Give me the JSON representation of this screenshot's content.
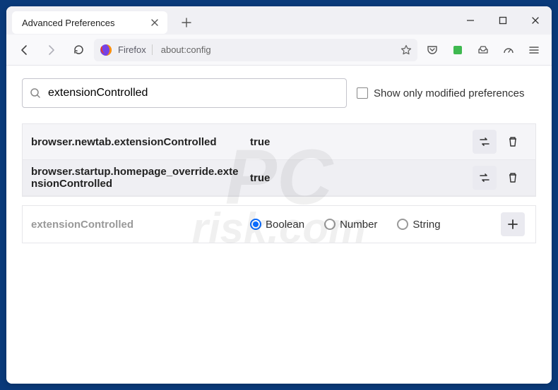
{
  "window": {
    "tab_title": "Advanced Preferences",
    "sys": {
      "min": "–",
      "max": "☐",
      "close": "✕"
    }
  },
  "toolbar": {
    "identity": "Firefox",
    "url": "about:config"
  },
  "search": {
    "value": "extensionControlled",
    "checkbox_label": "Show only modified preferences"
  },
  "prefs": [
    {
      "name": "browser.newtab.extensionControlled",
      "value": "true"
    },
    {
      "name": "browser.startup.homepage_override.extensionControlled",
      "value": "true"
    }
  ],
  "addrow": {
    "name": "extensionControlled",
    "types": [
      "Boolean",
      "Number",
      "String"
    ],
    "selected": 0
  },
  "watermark": {
    "line1": "PC",
    "line2": "risk.com"
  }
}
